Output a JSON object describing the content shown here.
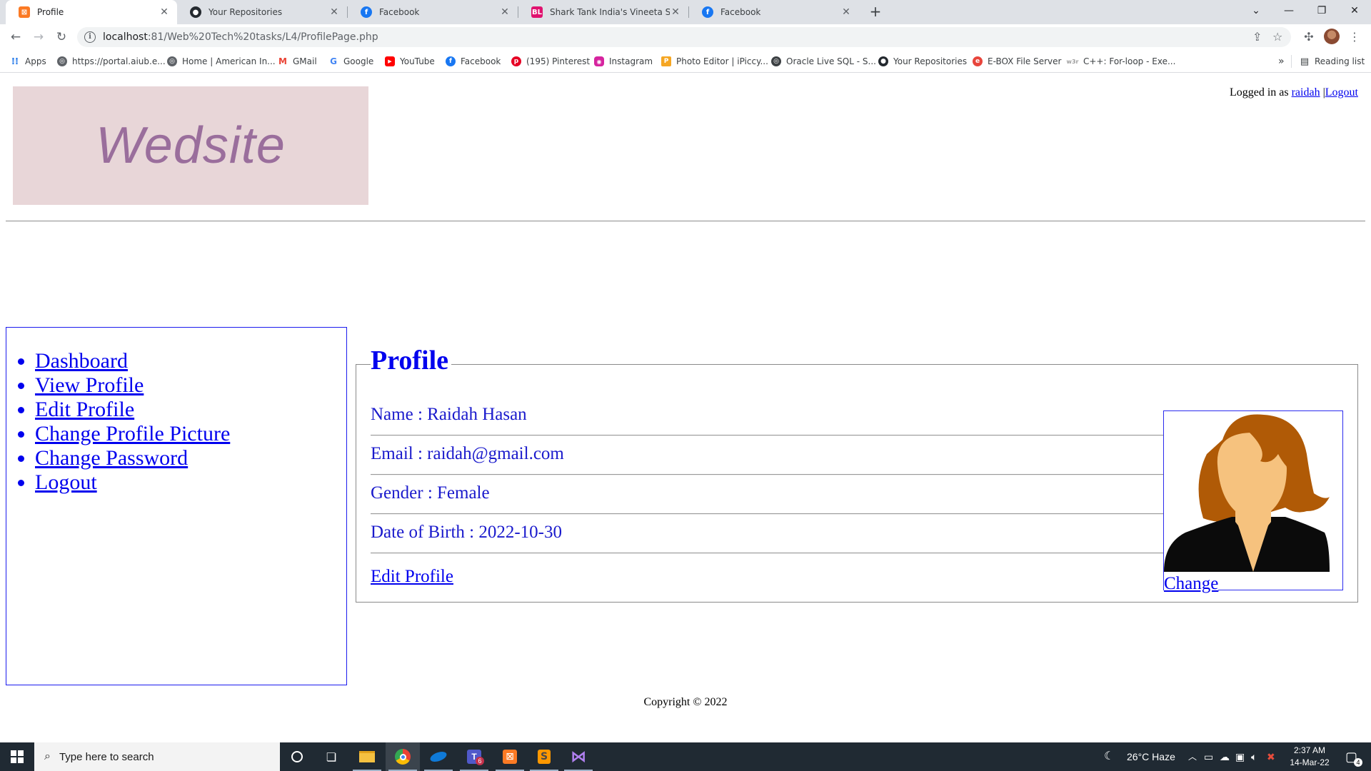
{
  "browser": {
    "tabs": [
      {
        "title": "Profile",
        "favicon": "xampp-icon",
        "color": "#fb7a24",
        "glyph": "⊠",
        "active": true
      },
      {
        "title": "Your Repositories",
        "favicon": "github-icon",
        "color": "#24292f",
        "glyph": "",
        "active": false
      },
      {
        "title": "Facebook",
        "favicon": "facebook-icon",
        "color": "#1877f2",
        "glyph": "f",
        "active": false
      },
      {
        "title": "Shark Tank India's Vineeta Singh",
        "favicon": "businesstoday-icon",
        "color": "#e0126f",
        "glyph": "BL",
        "active": false
      },
      {
        "title": "Facebook",
        "favicon": "facebook-icon",
        "color": "#1877f2",
        "glyph": "f",
        "active": false
      }
    ],
    "url_host": "localhost",
    "url_path": ":81/Web%20Tech%20tasks/L4/ProfilePage.php",
    "bookmarks": [
      {
        "label": "Apps",
        "icon": "apps-grid-icon",
        "color": "#ea4335"
      },
      {
        "label": "https://portal.aiub.e...",
        "icon": "globe-icon",
        "color": "#5f6368"
      },
      {
        "label": "Home | American In...",
        "icon": "globe-icon",
        "color": "#5f6368"
      },
      {
        "label": "GMail",
        "icon": "gmail-icon",
        "color": "#ea4335"
      },
      {
        "label": "Google",
        "icon": "google-icon",
        "color": "#4285f4"
      },
      {
        "label": "YouTube",
        "icon": "youtube-icon",
        "color": "#ff0000"
      },
      {
        "label": "Facebook",
        "icon": "facebook-icon",
        "color": "#1877f2"
      },
      {
        "label": "(195) Pinterest",
        "icon": "pinterest-icon",
        "color": "#e60023"
      },
      {
        "label": "Instagram",
        "icon": "instagram-icon",
        "color": "#d6249f"
      },
      {
        "label": "Photo Editor | iPiccy...",
        "icon": "ipiccy-icon",
        "color": "#f5a623"
      },
      {
        "label": "Oracle Live SQL - S...",
        "icon": "globe-icon",
        "color": "#3c4043"
      },
      {
        "label": "Your Repositories",
        "icon": "github-icon",
        "color": "#24292f"
      },
      {
        "label": "E-BOX File Server",
        "icon": "ebox-icon",
        "color": "#e8453c"
      },
      {
        "label": "C++: For-loop - Exe...",
        "icon": "w3resource-icon",
        "color": "#9e9e9e"
      }
    ],
    "overflow_label": "»",
    "reading_list_label": "Reading list"
  },
  "page": {
    "logo_text": "Wedsite",
    "login_prefix": "Logged in as ",
    "username": "raidah",
    "separator": "|",
    "logout_label": "Logout",
    "nav": [
      "Dashboard",
      "View Profile",
      "Edit Profile",
      "Change Profile Picture",
      "Change Password",
      "Logout"
    ],
    "profile": {
      "legend": "Profile",
      "name_line": "Name : Raidah Hasan",
      "email_line": "Email : raidah@gmail.com",
      "gender_line": "Gender : Female",
      "dob_line": "Date of Birth : 2022-10-30",
      "edit_label": "Edit Profile",
      "change_label": "Change"
    },
    "copyright": "Copyright © 2022"
  },
  "taskbar": {
    "search_placeholder": "Type here to search",
    "weather": "26°C  Haze",
    "time": "2:37 AM",
    "date": "14-Mar-22",
    "notification_count": "4",
    "teams_badge": "6"
  }
}
